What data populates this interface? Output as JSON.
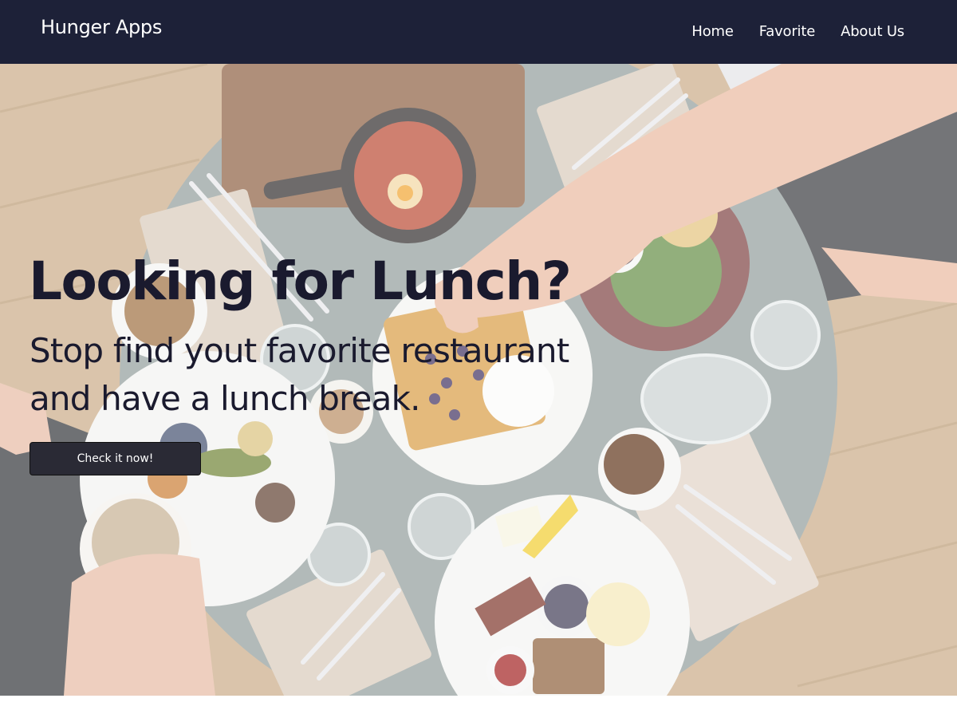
{
  "app": {
    "brand": "Hunger Apps"
  },
  "nav": {
    "items": [
      {
        "label": "Home"
      },
      {
        "label": "Favorite"
      },
      {
        "label": "About Us"
      }
    ]
  },
  "hero": {
    "title": "Looking for Lunch?",
    "subtitle": "Stop find yout favorite restaurant and have a lunch break.",
    "cta_label": "Check it now!"
  },
  "colors": {
    "navbar_bg": "#1d2138",
    "button_bg": "#2a2a35",
    "text_dark": "#1a1a2e"
  }
}
